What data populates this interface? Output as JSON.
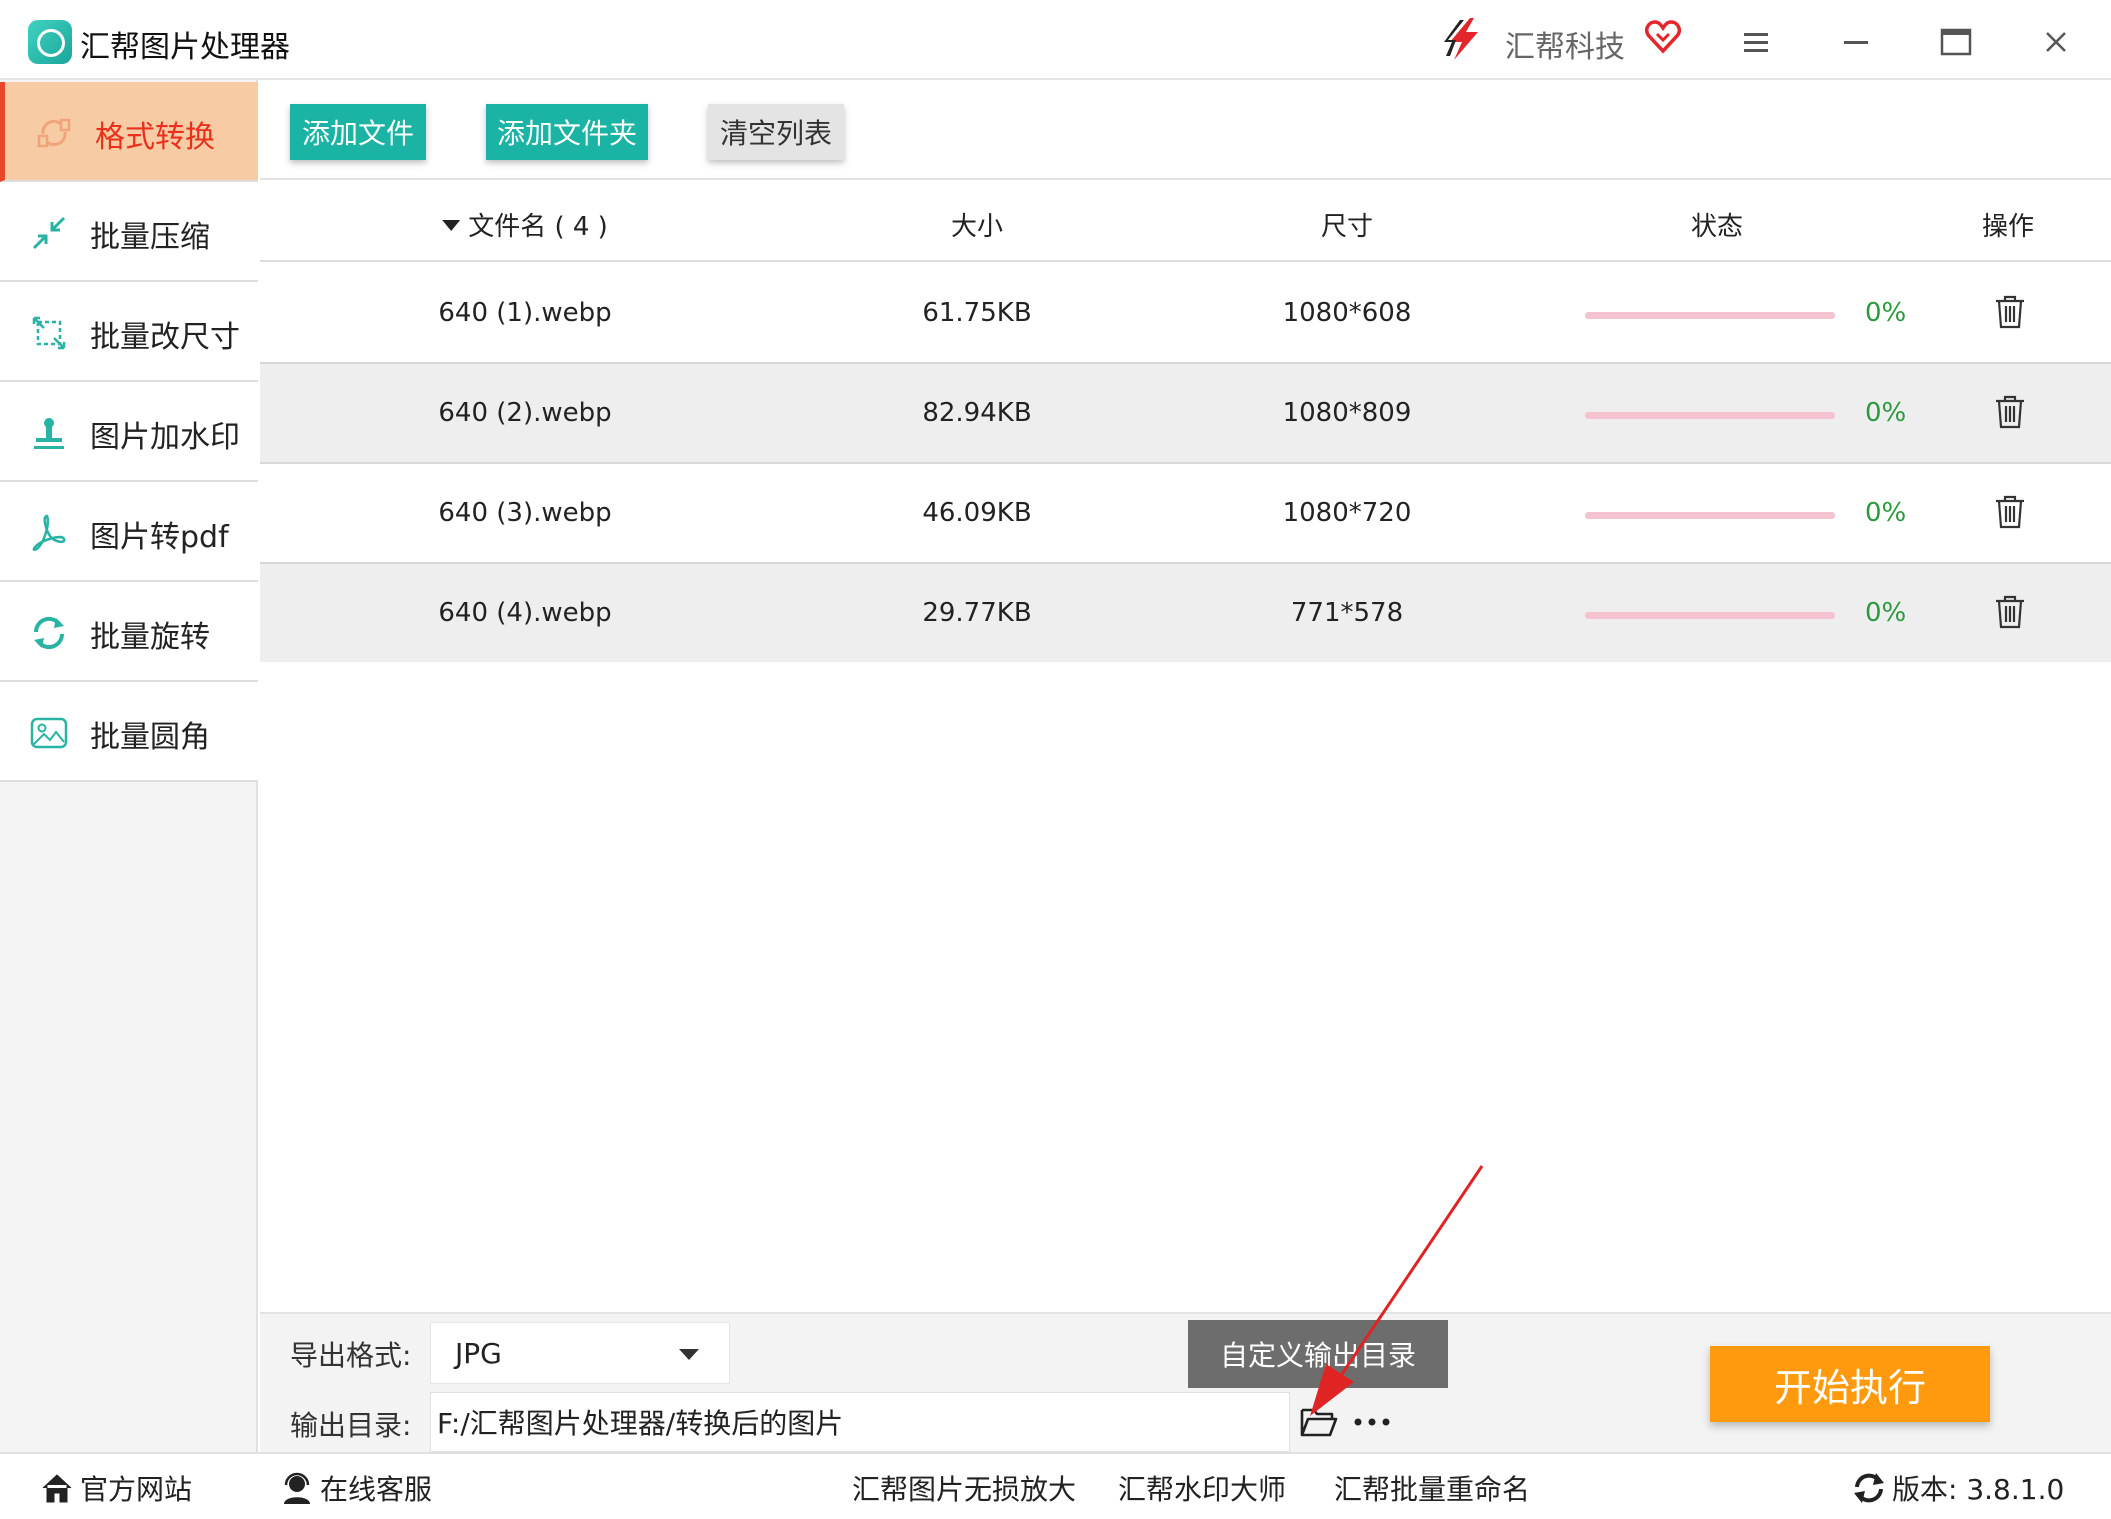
{
  "app": {
    "title": "汇帮图片处理器",
    "brand": "汇帮科技",
    "colors": {
      "accent": "#1bb3a3",
      "active_bg": "#f7cba3",
      "active_text": "#e8301c",
      "start": "#ff9a0f",
      "progress": "#f5c3cf",
      "percent": "#2a9a3c"
    }
  },
  "window_controls": [
    "menu-icon",
    "minimize-icon",
    "maximize-icon",
    "close-icon"
  ],
  "sidebar": {
    "items": [
      {
        "label": "格式转换",
        "icon": "format-convert-icon",
        "active": true
      },
      {
        "label": "批量压缩",
        "icon": "compress-icon",
        "active": false
      },
      {
        "label": "批量改尺寸",
        "icon": "resize-icon",
        "active": false
      },
      {
        "label": "图片加水印",
        "icon": "watermark-icon",
        "active": false
      },
      {
        "label": "图片转pdf",
        "icon": "pdf-icon",
        "active": false
      },
      {
        "label": "批量旋转",
        "icon": "rotate-icon",
        "active": false
      },
      {
        "label": "批量圆角",
        "icon": "rounded-corner-icon",
        "active": false
      }
    ]
  },
  "toolbar": {
    "add_file": "添加文件",
    "add_folder": "添加文件夹",
    "clear_list": "清空列表"
  },
  "table": {
    "headers": {
      "name": "文件名 ( 4 )",
      "size": "大小",
      "dimensions": "尺寸",
      "status": "状态",
      "action": "操作"
    },
    "rows": [
      {
        "name": "640 (1).webp",
        "size": "61.75KB",
        "dimensions": "1080*608",
        "progress": "0%"
      },
      {
        "name": "640 (2).webp",
        "size": "82.94KB",
        "dimensions": "1080*809",
        "progress": "0%"
      },
      {
        "name": "640 (3).webp",
        "size": "46.09KB",
        "dimensions": "1080*720",
        "progress": "0%"
      },
      {
        "name": "640 (4).webp",
        "size": "29.77KB",
        "dimensions": "771*578",
        "progress": "0%"
      }
    ]
  },
  "settings": {
    "format_label": "导出格式:",
    "format_value": "JPG",
    "dir_label": "输出目录:",
    "dir_value": "F:/汇帮图片处理器/转换后的图片",
    "tooltip": "自定义输出目录",
    "start": "开始执行"
  },
  "footer": {
    "website": "官方网站",
    "support": "在线客服",
    "link1": "汇帮图片无损放大",
    "link2": "汇帮水印大师",
    "link3": "汇帮批量重命名",
    "version": "版本: 3.8.1.0"
  }
}
